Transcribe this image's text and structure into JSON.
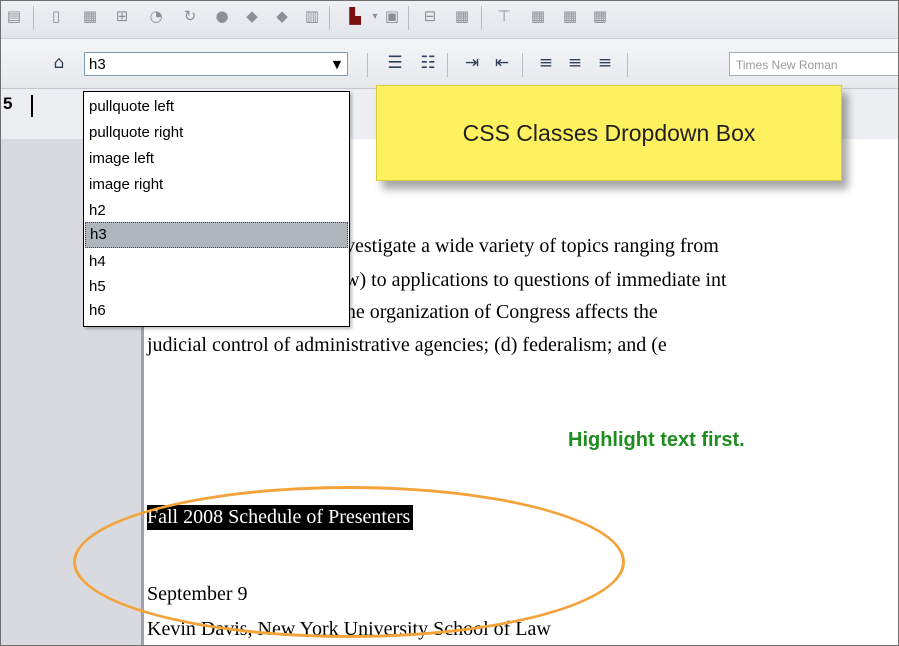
{
  "toolbar_top": {
    "icons": [
      "table-props-icon",
      "page-icon",
      "grid-icon",
      "insert-icon",
      "image-tool-icon",
      "refresh-icon",
      "info-icon",
      "left-arrow-icon",
      "right-arrow-icon",
      "columns-icon",
      "color-picker-icon",
      "dropdown-arrow-icon",
      "table-icon",
      "table-insert-icon",
      "table-delete-icon",
      "cell-icon",
      "merge-icon",
      "split-icon",
      "grid2-icon"
    ]
  },
  "toolbar_format": {
    "css_class_value": "h3",
    "font_name": "Times New Roman",
    "icons": [
      "style-icon",
      "numbered-list-icon",
      "bullet-list-icon",
      "indent-icon",
      "outdent-icon",
      "align-left-icon",
      "align-center-icon",
      "align-right-icon"
    ]
  },
  "ruler": {
    "number": "5"
  },
  "css_class_dropdown": {
    "options": [
      "pullquote left",
      "pullquote right",
      "image left",
      "image right",
      "h2",
      "h3",
      "h4",
      "h5",
      "h6"
    ],
    "selected": "h3"
  },
  "callout": {
    "text": "CSS Classes Dropdown Box"
  },
  "document": {
    "paragraph_lines": [
      "vestigate a wide variety of topics ranging from",
      "w) to applications to questions of immediate int",
      "the law such as (a) how the organization of Congress affects the",
      "judicial control of administrative agencies; (d) federalism; and (e"
    ],
    "highlight_hint": "Highlight text first.",
    "selected_heading": "Fall 2008 Schedule of Presenters",
    "date_line": "September 9",
    "presenter_line": "Kevin Davis, New York University School of Law"
  },
  "colors": {
    "callout_bg": "#fdf160",
    "hint_green": "#1e8c1e",
    "ellipse_orange": "#f3a33a",
    "selection_bg": "#000000"
  }
}
